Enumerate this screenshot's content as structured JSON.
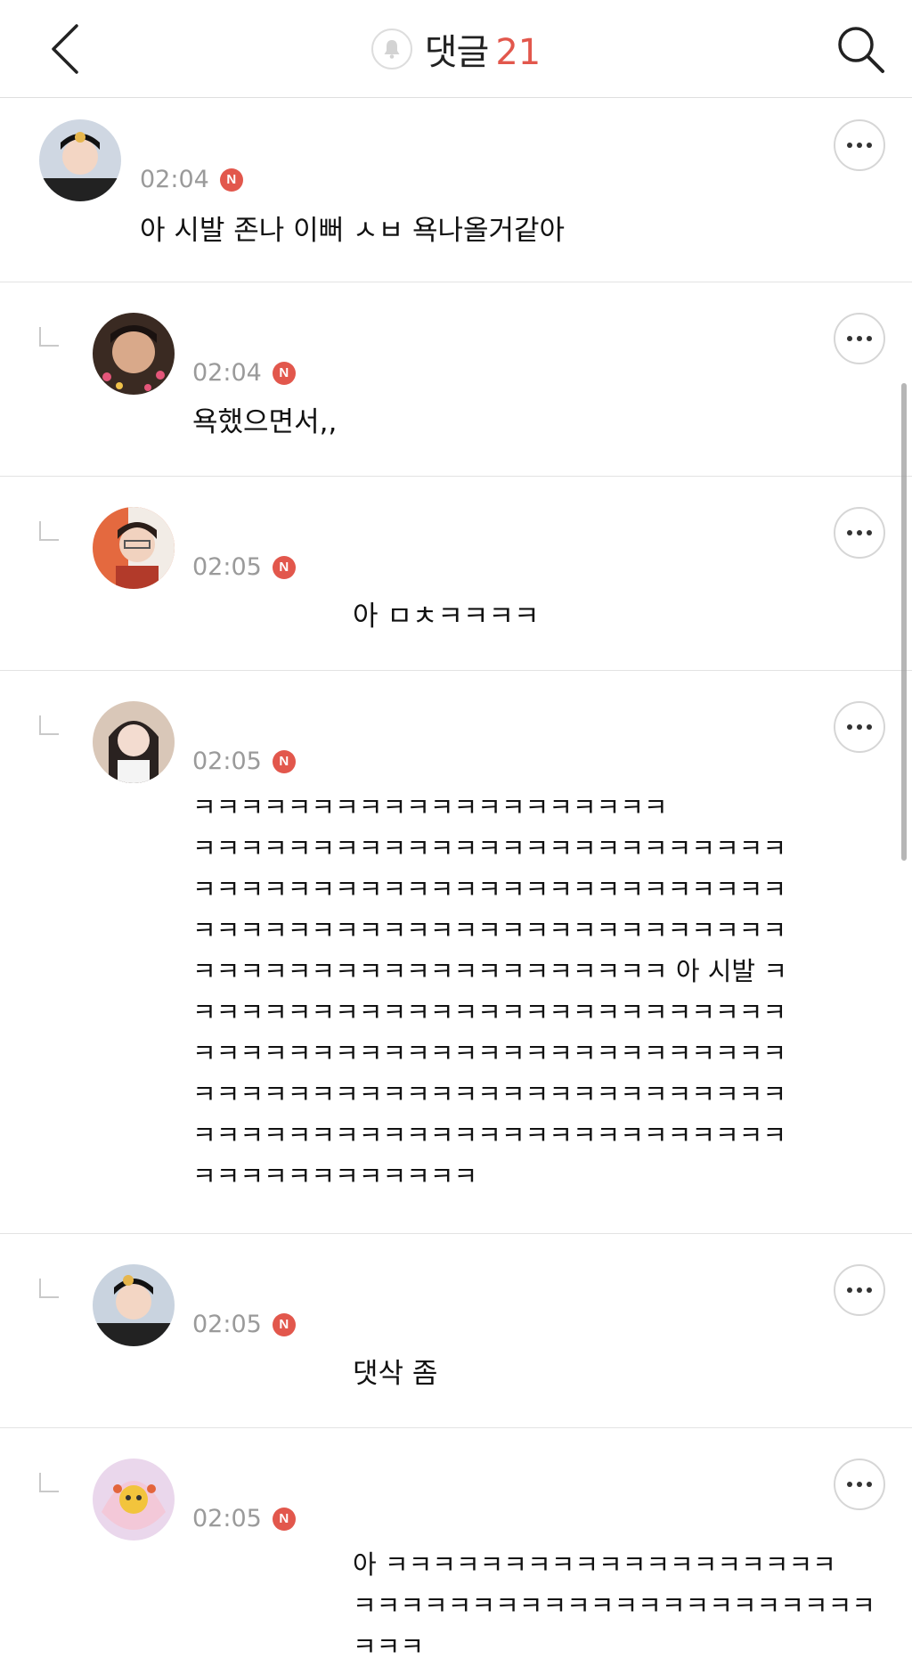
{
  "header": {
    "title": "댓글",
    "count": "21"
  },
  "colors": {
    "accent": "#e2574c",
    "divider": "#e3e3e3",
    "meta_text": "#9a9a9a"
  },
  "icons": {
    "back": "chevron-left-icon",
    "notification": "bell-icon",
    "search": "search-icon",
    "more": "more-horizontal-icon",
    "reply": "reply-corner-icon"
  },
  "comments": [
    {
      "author": "",
      "time": "02:04",
      "new_badge": "N",
      "text": "아 시발 존나 이뻐 ㅅㅂ 욕나올거같아",
      "is_reply": false
    },
    {
      "author": "",
      "time": "02:04",
      "new_badge": "N",
      "text": "욕했으면서,,",
      "is_reply": true
    },
    {
      "author": "",
      "time": "02:05",
      "new_badge": "N",
      "text": "아 ㅁㅊㅋㅋㅋㅋ",
      "is_reply": true
    },
    {
      "author": "",
      "time": "02:05",
      "new_badge": "N",
      "text": "ㅋㅋㅋㅋㅋㅋㅋㅋㅋㅋㅋㅋㅋㅋㅋㅋㅋㅋㅋㅋ\nㅋㅋㅋㅋㅋㅋㅋㅋㅋㅋㅋㅋㅋㅋㅋㅋㅋㅋㅋㅋㅋㅋㅋㅋㅋ\nㅋㅋㅋㅋㅋㅋㅋㅋㅋㅋㅋㅋㅋㅋㅋㅋㅋㅋㅋㅋㅋㅋㅋㅋㅋ\nㅋㅋㅋㅋㅋㅋㅋㅋㅋㅋㅋㅋㅋㅋㅋㅋㅋㅋㅋㅋㅋㅋㅋㅋㅋ\nㅋㅋㅋㅋㅋㅋㅋㅋㅋㅋㅋㅋㅋㅋㅋㅋㅋㅋㅋㅋ 아 시발 ㅋ\nㅋㅋㅋㅋㅋㅋㅋㅋㅋㅋㅋㅋㅋㅋㅋㅋㅋㅋㅋㅋㅋㅋㅋㅋㅋ\nㅋㅋㅋㅋㅋㅋㅋㅋㅋㅋㅋㅋㅋㅋㅋㅋㅋㅋㅋㅋㅋㅋㅋㅋㅋ\nㅋㅋㅋㅋㅋㅋㅋㅋㅋㅋㅋㅋㅋㅋㅋㅋㅋㅋㅋㅋㅋㅋㅋㅋㅋ\nㅋㅋㅋㅋㅋㅋㅋㅋㅋㅋㅋㅋㅋㅋㅋㅋㅋㅋㅋㅋㅋㅋㅋㅋㅋ\nㅋㅋㅋㅋㅋㅋㅋㅋㅋㅋㅋㅋ",
      "is_reply": true
    },
    {
      "author": "",
      "time": "02:05",
      "new_badge": "N",
      "text": "댓삭 좀",
      "is_reply": true
    },
    {
      "author": "",
      "time": "02:05",
      "new_badge": "N",
      "text": "아 ㅋㅋㅋㅋㅋㅋㅋㅋㅋㅋㅋㅋㅋㅋㅋㅋㅋㅋㅋ\nㅋㅋㅋㅋㅋㅋㅋㅋㅋㅋㅋㅋㅋㅋㅋㅋㅋㅋㅋㅋㅋㅋㅋㅋㅋ",
      "is_reply": true
    }
  ]
}
